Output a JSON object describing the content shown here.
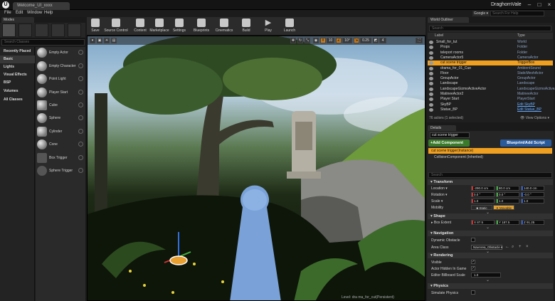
{
  "titlebar": {
    "tab": "Welcome_UI_xxxx",
    "project": "DraghornVale"
  },
  "menu": [
    "File",
    "Edit",
    "Window",
    "Help"
  ],
  "help_search": {
    "dropdown": "Google",
    "placeholder": "Search For Help"
  },
  "modes": {
    "tab": "Modes",
    "search_placeholder": "Search Classes"
  },
  "categories": [
    "Recently Placed",
    "Basic",
    "Lights",
    "Visual Effects",
    "BSP",
    "Volumes",
    "All Classes"
  ],
  "place_items": [
    "Empty Actor",
    "Empty Character",
    "Point Light",
    "Player Start",
    "Cube",
    "Sphere",
    "Cylinder",
    "Cone",
    "Box Trigger",
    "Sphere Trigger"
  ],
  "toolbar": [
    "Save",
    "Source Control",
    "Content",
    "Marketplace",
    "Settings",
    "Blueprints",
    "Cinematics",
    "Build",
    "Play",
    "Launch"
  ],
  "viewport": {
    "grid": "10",
    "rot": "10°",
    "scale": "0.25",
    "cam": "4",
    "stat": "Level: dra ma_for_cut(Persistent)"
  },
  "outliner": {
    "tab": "World Outliner",
    "search_placeholder": "Search",
    "col_label": "Label",
    "col_type": "Type",
    "rows": [
      {
        "label": "Small_for_tut",
        "type": "World",
        "indent": 0,
        "sel": false
      },
      {
        "label": "Props",
        "type": "Folder",
        "indent": 1,
        "sel": false
      },
      {
        "label": "teleport rooms",
        "type": "Folder",
        "indent": 1,
        "sel": false
      },
      {
        "label": "CameraActor5",
        "type": "CameraActor",
        "indent": 1,
        "sel": false
      },
      {
        "label": "cut scene trigger",
        "type": "TriggerBox",
        "indent": 1,
        "sel": true
      },
      {
        "label": "drama_for_01_Cue",
        "type": "AmbientSound",
        "indent": 1,
        "sel": false
      },
      {
        "label": "Floor",
        "type": "StaticMeshActor",
        "indent": 1,
        "sel": false
      },
      {
        "label": "GroupActor",
        "type": "GroupActor",
        "indent": 1,
        "sel": false
      },
      {
        "label": "Landscape",
        "type": "Landscape",
        "indent": 1,
        "sel": false
      },
      {
        "label": "LandscapeGizmoActiveActor",
        "type": "LandscapeGizmoActiveActor",
        "indent": 1,
        "sel": false
      },
      {
        "label": "MatineeActor2",
        "type": "MatineeActor",
        "indent": 1,
        "sel": false
      },
      {
        "label": "Player Start",
        "type": "PlayerStart",
        "indent": 1,
        "sel": false
      },
      {
        "label": "SkyBP",
        "type": "Edit SkyBP",
        "indent": 1,
        "sel": false,
        "link": true
      },
      {
        "label": "Statue_BP",
        "type": "Edit Statue_BP",
        "indent": 1,
        "sel": false,
        "link": true
      }
    ],
    "footer": "76 actors (1 selected)",
    "view_options": "View Options"
  },
  "details": {
    "tab": "Details",
    "name": "cut scene trigger",
    "add_component": "+Add Component",
    "blueprint_btn": "Blueprint/Add Script",
    "component_root": "cut scene trigger(Instance)",
    "component_child": "CollisionComponent (Inherited)",
    "search_placeholder": "Search",
    "transform": {
      "title": "Transform",
      "location_label": "Location",
      "location": [
        "-290.0 cm",
        "80.0 cm",
        "140.0 cm"
      ],
      "rotation_label": "Rotation",
      "rotation": [
        "0.0 °",
        "0.0 °",
        "-0.0 °"
      ],
      "scale_label": "Scale",
      "scale": [
        "1.0",
        "1.0",
        "1.0"
      ],
      "mobility_label": "Mobility",
      "mobility_static": "Static",
      "mobility_movable": "Movable"
    },
    "shape": {
      "title": "Shape",
      "box_extent_label": "Box Extent",
      "box_extent": [
        "X 87.5",
        "Y 187.5",
        "Z 91.25"
      ]
    },
    "navigation": {
      "title": "Navigation",
      "dynamic_label": "Dynamic Obstacle",
      "area_label": "Area Class",
      "area_value": "NavArea_Obstacle"
    },
    "rendering": {
      "title": "Rendering",
      "visible_label": "Visible",
      "hidden_label": "Actor Hidden In Game",
      "billboard_label": "Editor Billboard Scale",
      "billboard_value": "1.0"
    },
    "physics": {
      "title": "Physics",
      "simulate_label": "Simulate Physics"
    }
  },
  "colors": {
    "accent": "#f0a020",
    "green": "#3a7a2a",
    "blue": "#2a5a9a"
  }
}
